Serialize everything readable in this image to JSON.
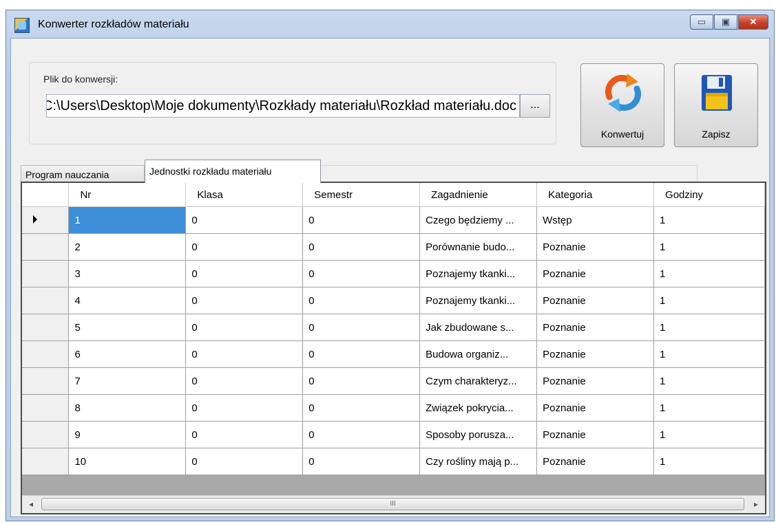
{
  "window": {
    "title": "Konwerter rozkładów materiału",
    "controls": {
      "minimize": "▭",
      "maximize": "▣",
      "close": "✕"
    }
  },
  "file_group": {
    "label": "Plik do konwersji:",
    "path_value": "C:\\Users\\Desktop\\Moje dokumenty\\Rozkłady materiału\\Rozkład materiału.doc",
    "browse_label": "..."
  },
  "buttons": {
    "convert_label": "Konwertuj",
    "save_label": "Zapisz"
  },
  "tabs": [
    {
      "label": "Program nauczania",
      "active": false
    },
    {
      "label": "Jednostki rozkładu materiału",
      "active": true
    }
  ],
  "grid": {
    "columns": [
      "Nr",
      "Klasa",
      "Semestr",
      "Zagadnienie",
      "Kategoria",
      "Godziny"
    ],
    "rows": [
      [
        "1",
        "0",
        "0",
        "Czego będziemy ...",
        "Wstęp",
        "1"
      ],
      [
        "2",
        "0",
        "0",
        "Porównanie budo...",
        "Poznanie",
        "1"
      ],
      [
        "3",
        "0",
        "0",
        "Poznajemy tkanki...",
        "Poznanie",
        "1"
      ],
      [
        "4",
        "0",
        "0",
        "Poznajemy tkanki...",
        "Poznanie",
        "1"
      ],
      [
        "5",
        "0",
        "0",
        "Jak zbudowane s...",
        "Poznanie",
        "1"
      ],
      [
        "6",
        "0",
        "0",
        "Budowa organiz...",
        "Poznanie",
        "1"
      ],
      [
        "7",
        "0",
        "0",
        "Czym charakteryz...",
        "Poznanie",
        "1"
      ],
      [
        "8",
        "0",
        "0",
        "Związek pokrycia...",
        "Poznanie",
        "1"
      ],
      [
        "9",
        "0",
        "0",
        "Sposoby porusza...",
        "Poznanie",
        "1"
      ],
      [
        "10",
        "0",
        "0",
        "Czy rośliny mają p...",
        "Poznanie",
        "1"
      ]
    ],
    "selected_row": 0
  },
  "scrollbar": {
    "left": "◂",
    "right": "▸",
    "grip": "III"
  },
  "colors": {
    "selection": "#3d8ed8",
    "title_bg": "#c9d9ee",
    "close_button": "#c8412a"
  }
}
